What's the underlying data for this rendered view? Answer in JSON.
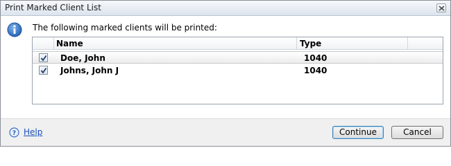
{
  "window": {
    "title": "Print Marked Client List"
  },
  "message": "The following marked clients will be printed:",
  "list": {
    "columns": [
      "Name",
      "Type"
    ],
    "rows": [
      {
        "checked": true,
        "name": "Doe, John",
        "type": "1040",
        "selected": true
      },
      {
        "checked": true,
        "name": "Johns, John J",
        "type": "1040",
        "selected": false
      }
    ]
  },
  "footer": {
    "help_label": "Help",
    "continue_label": "Continue",
    "cancel_label": "Cancel"
  },
  "icons": {
    "info": "info-icon",
    "help": "help-icon",
    "close": "close-icon",
    "check": "checkmark-icon"
  },
  "colors": {
    "accent": "#1a4fbf",
    "info_blue": "#2f6fc1"
  }
}
